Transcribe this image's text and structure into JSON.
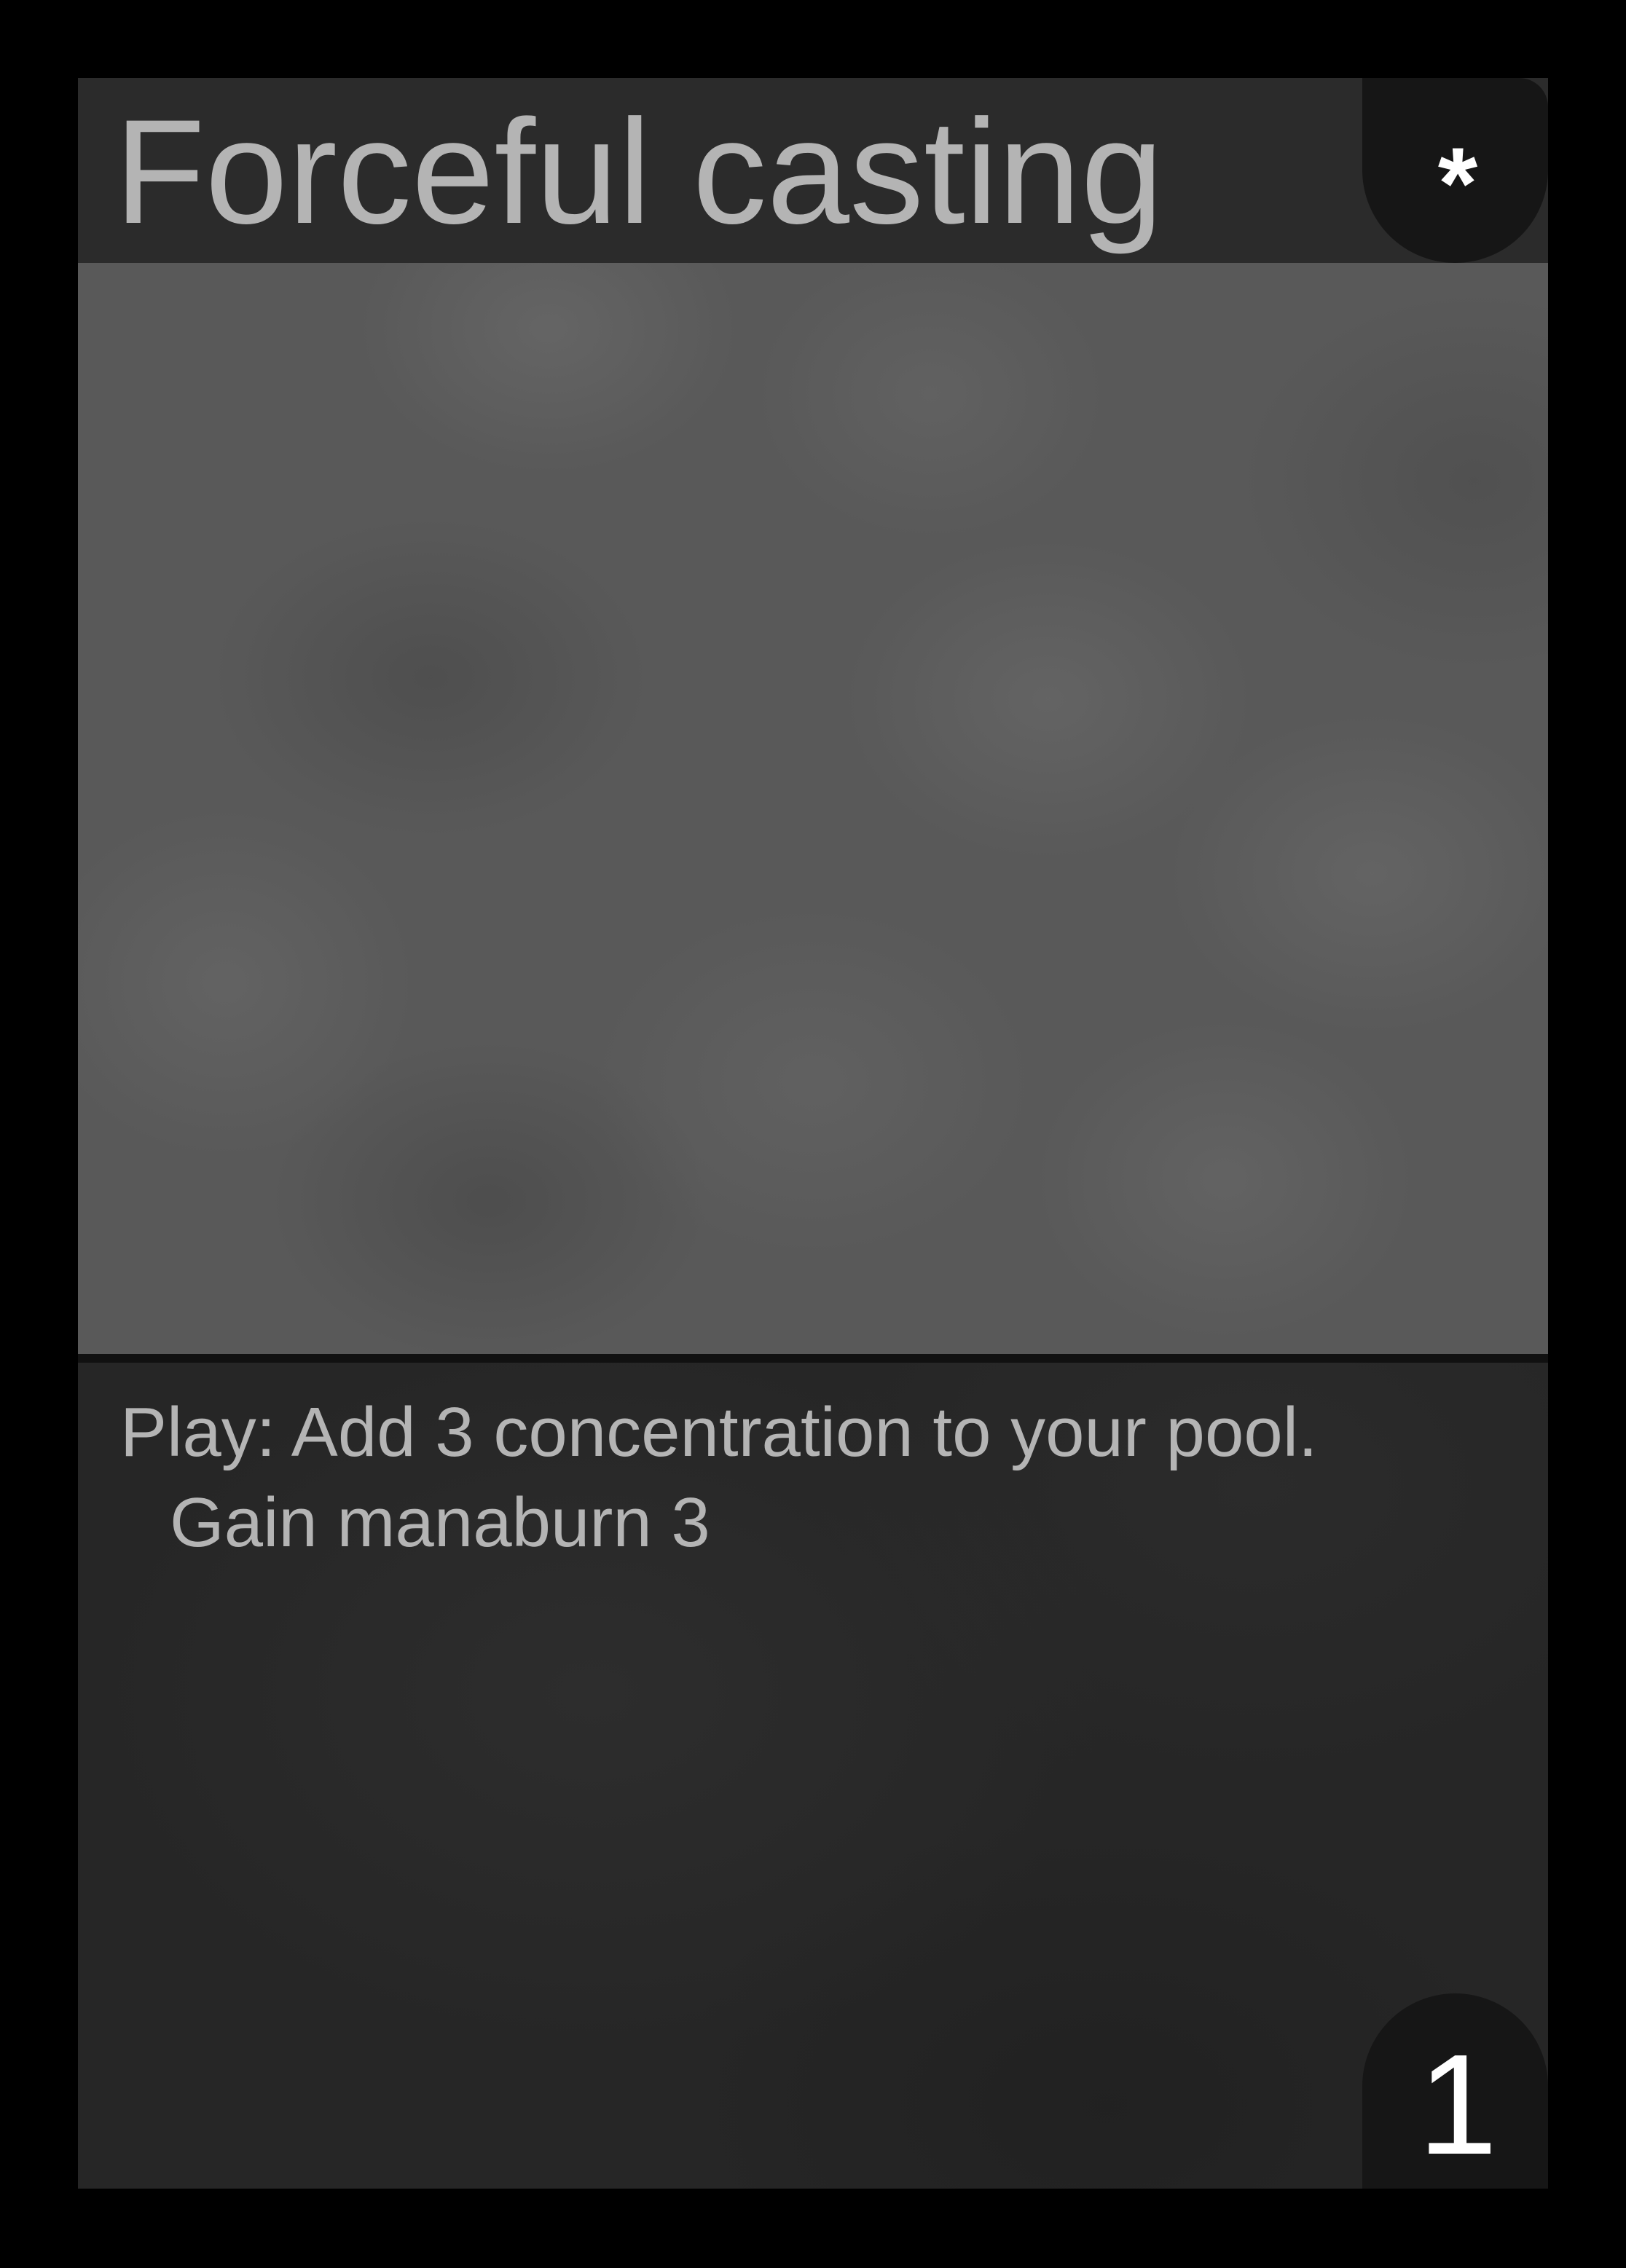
{
  "card": {
    "title": "Forceful casting",
    "cost_symbol": "*",
    "rules_text": "Play: Add 3 concentration to your pool. Gain manaburn 3",
    "number": "1",
    "colors": {
      "page_background": "#000000",
      "title_text": "#b4b4b4",
      "badge_background": "#161616",
      "badge_text": "#ffffff"
    }
  }
}
